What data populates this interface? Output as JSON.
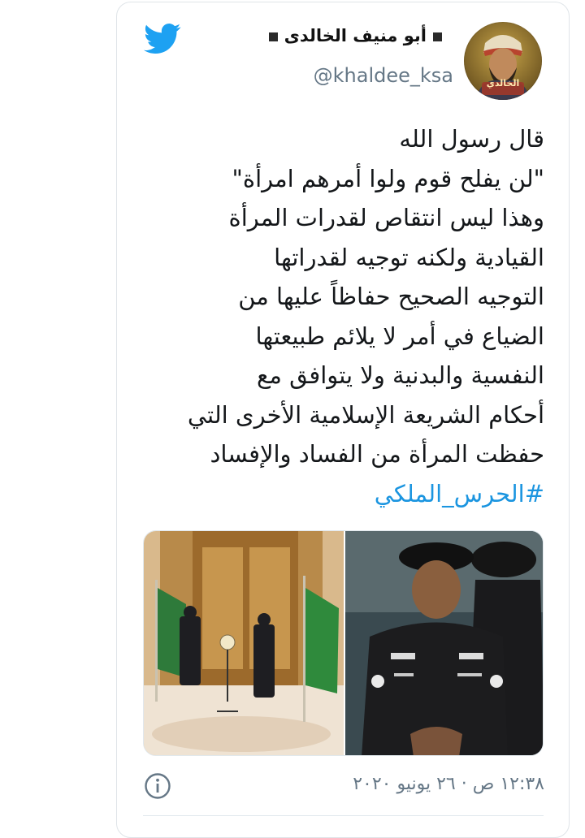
{
  "tweet": {
    "author_name": "أبو منيف الخالدى",
    "handle": "@khaldee_ksa",
    "avatar_label": "الخالدي",
    "lines": [
      "قال رسول الله",
      "\"لن يفلح قوم ولوا أمرهم امرأة\"",
      "وهذا ليس انتقاص لقدرات المرأة",
      "القيادية  ولكنه توجيه لقدراتها",
      "التوجيه الصحيح حفاظاً عليها من",
      "الضياع في أمر لا يلائم طبيعتها",
      "النفسية والبدنية ولا يتوافق مع",
      "أحكام الشريعة الإسلامية الأخرى التي",
      "حفظت المرأة من الفساد والإفساد"
    ],
    "hashtag": "#الحرس_الملكي",
    "timestamp": "١٢:٣٨ ص · ٢٦ يونيو ٢٠٢٠"
  },
  "icons": {
    "platform": "twitter-bird-icon",
    "info": "info-icon"
  },
  "colors": {
    "brand_blue": "#1da1f2",
    "link_blue": "#1b95e0",
    "secondary_text": "#657786",
    "primary_text": "#14171a"
  }
}
